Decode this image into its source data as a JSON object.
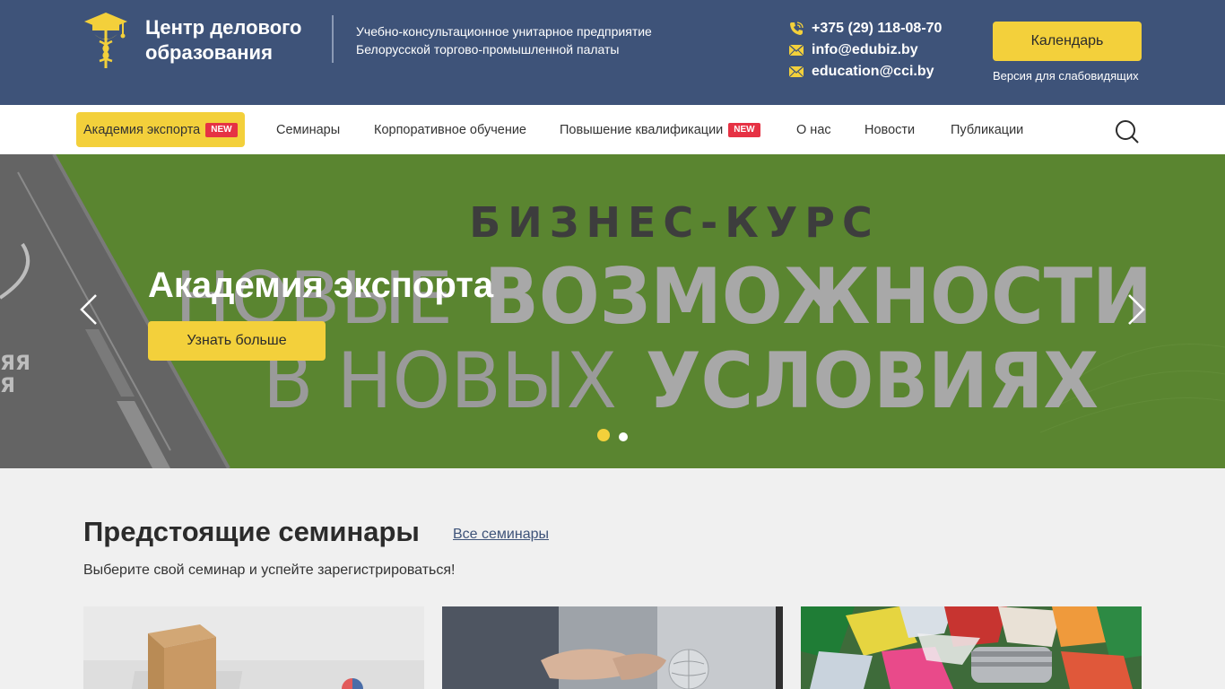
{
  "header": {
    "brand_line1": "Центр делового",
    "brand_line2": "образования",
    "org_line1": "Учебно-консультационное унитарное предприятие",
    "org_line2": "Белорусской торгово-промышленной палаты",
    "phone": "+375 (29) 118-08-70",
    "email1": "info@edubiz.by",
    "email2": "education@cci.by",
    "calendar_label": "Календарь",
    "accessible_label": "Версия для слабовидящих"
  },
  "nav": {
    "items": [
      {
        "label": "Академия экспорта",
        "badge": "NEW"
      },
      {
        "label": "Семинары"
      },
      {
        "label": "Корпоративное обучение"
      },
      {
        "label": "Повышение квалификации",
        "badge": "NEW"
      },
      {
        "label": "О нас"
      },
      {
        "label": "Новости"
      },
      {
        "label": "Публикации"
      }
    ],
    "search_icon": "search-icon"
  },
  "hero": {
    "title": "Академия экспорта",
    "button_label": "Узнать больше",
    "banner_line1": "БИЗНЕС-КУРС",
    "banner_line2_light": "НОВЫЕ",
    "banner_line2_bold": "ВОЗМОЖНОСТИ",
    "banner_line3_light": "В НОВЫХ",
    "banner_line3_bold": "УСЛОВИЯХ",
    "side_text1": "ЯЯ",
    "side_text2": "Я",
    "slides_total": 2,
    "active_slide": 1
  },
  "seminars": {
    "title": "Предстоящие семинары",
    "all_link": "Все семинары",
    "subtitle": "Выберите свой семинар и успейте зарегистрироваться!"
  },
  "colors": {
    "header_bg": "#3e5379",
    "accent": "#f3d03b",
    "badge": "#e63244",
    "hero_green": "#5a8530"
  }
}
